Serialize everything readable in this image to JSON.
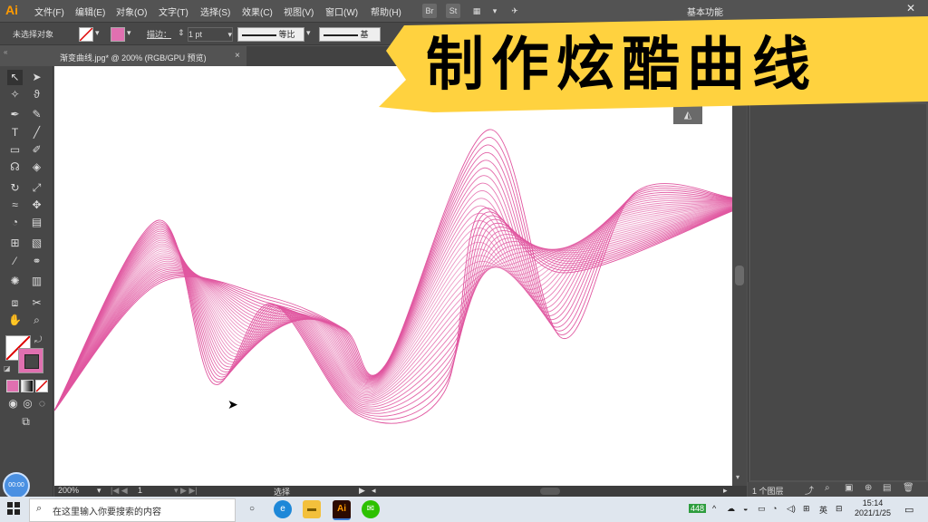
{
  "app": {
    "logo": "Ai"
  },
  "menu": [
    {
      "label": "文件(F)"
    },
    {
      "label": "编辑(E)"
    },
    {
      "label": "对象(O)"
    },
    {
      "label": "文字(T)"
    },
    {
      "label": "选择(S)"
    },
    {
      "label": "效果(C)"
    },
    {
      "label": "视图(V)"
    },
    {
      "label": "窗口(W)"
    },
    {
      "label": "帮助(H)"
    }
  ],
  "menubar_buttons": {
    "br": "Br",
    "st": "St"
  },
  "workspace": "基本功能",
  "controlbar": {
    "selection": "未选择对象",
    "stroke_label": "描边：",
    "stroke_value": "1 pt",
    "profile1": "等比",
    "profile2": "基"
  },
  "document_tab": {
    "title": "渐变曲线.jpg* @ 200% (RGB/GPU 预览)",
    "close": "×"
  },
  "banner": {
    "text": "制作炫酷曲线",
    "color": "#ffd23f"
  },
  "status": {
    "zoom": "200%",
    "page": "1",
    "mode": "选择"
  },
  "layers": {
    "count": "1 个图层"
  },
  "avatar_text": "00:00",
  "taskbar": {
    "search_placeholder": "在这里输入你要搜索的内容",
    "tray_battery": "448",
    "tray_lang": "英",
    "clock_time": "15:14",
    "clock_date": "2021/1/25"
  },
  "colors": {
    "curve": "#e0559f",
    "ui_bg": "#535353",
    "banner": "#ffd23f"
  }
}
